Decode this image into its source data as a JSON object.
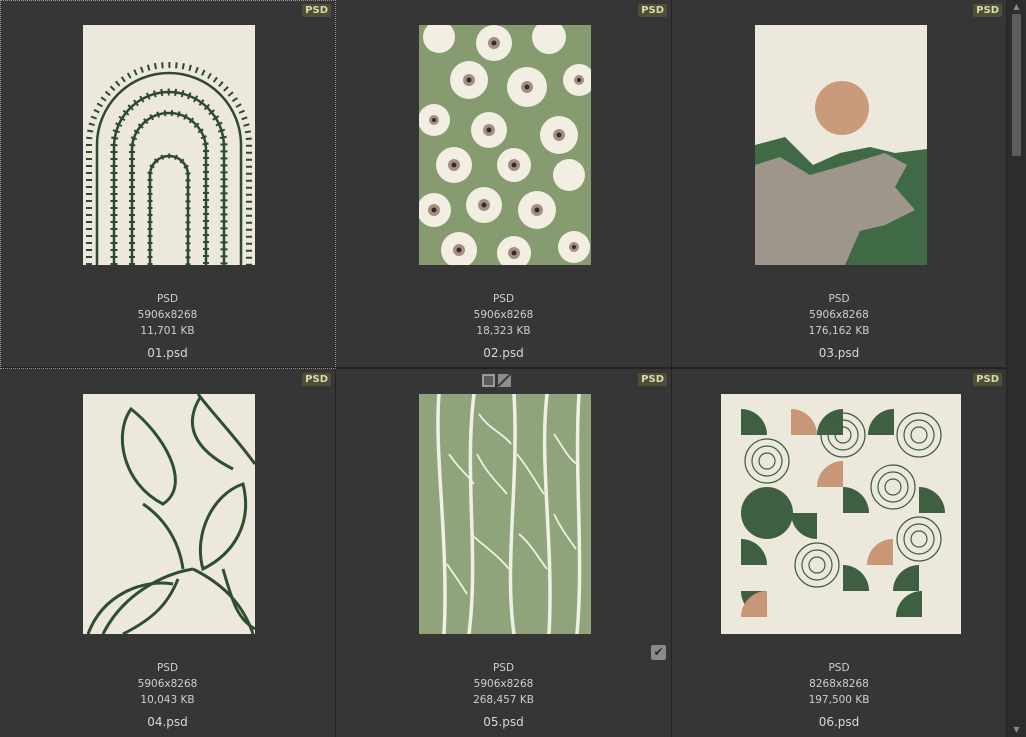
{
  "files": [
    {
      "badge": "PSD",
      "format": "PSD",
      "dimensions": "5906x8268",
      "size": "11,701 KB",
      "name": "01.psd"
    },
    {
      "badge": "PSD",
      "format": "PSD",
      "dimensions": "5906x8268",
      "size": "18,323 KB",
      "name": "02.psd"
    },
    {
      "badge": "PSD",
      "format": "PSD",
      "dimensions": "5906x8268",
      "size": "176,162 KB",
      "name": "03.psd"
    },
    {
      "badge": "PSD",
      "format": "PSD",
      "dimensions": "5906x8268",
      "size": "10,043 KB",
      "name": "04.psd"
    },
    {
      "badge": "PSD",
      "format": "PSD",
      "dimensions": "5906x8268",
      "size": "268,457 KB",
      "name": "05.psd"
    },
    {
      "badge": "PSD",
      "format": "PSD",
      "dimensions": "8268x8268",
      "size": "197,500 KB",
      "name": "06.psd"
    }
  ],
  "icons": {
    "checkbox": "check-icon",
    "overlay": [
      "frame-icon",
      "no-fill-icon"
    ],
    "scroll_up": "chevron-up-icon",
    "scroll_down": "chevron-down-icon"
  },
  "colors": {
    "cell_bg": "#363636",
    "badge_bg": "#4f4f36",
    "sage": "#869c70",
    "forest": "#3a5a3a",
    "cream": "#ece8de",
    "terracotta": "#c99677"
  }
}
